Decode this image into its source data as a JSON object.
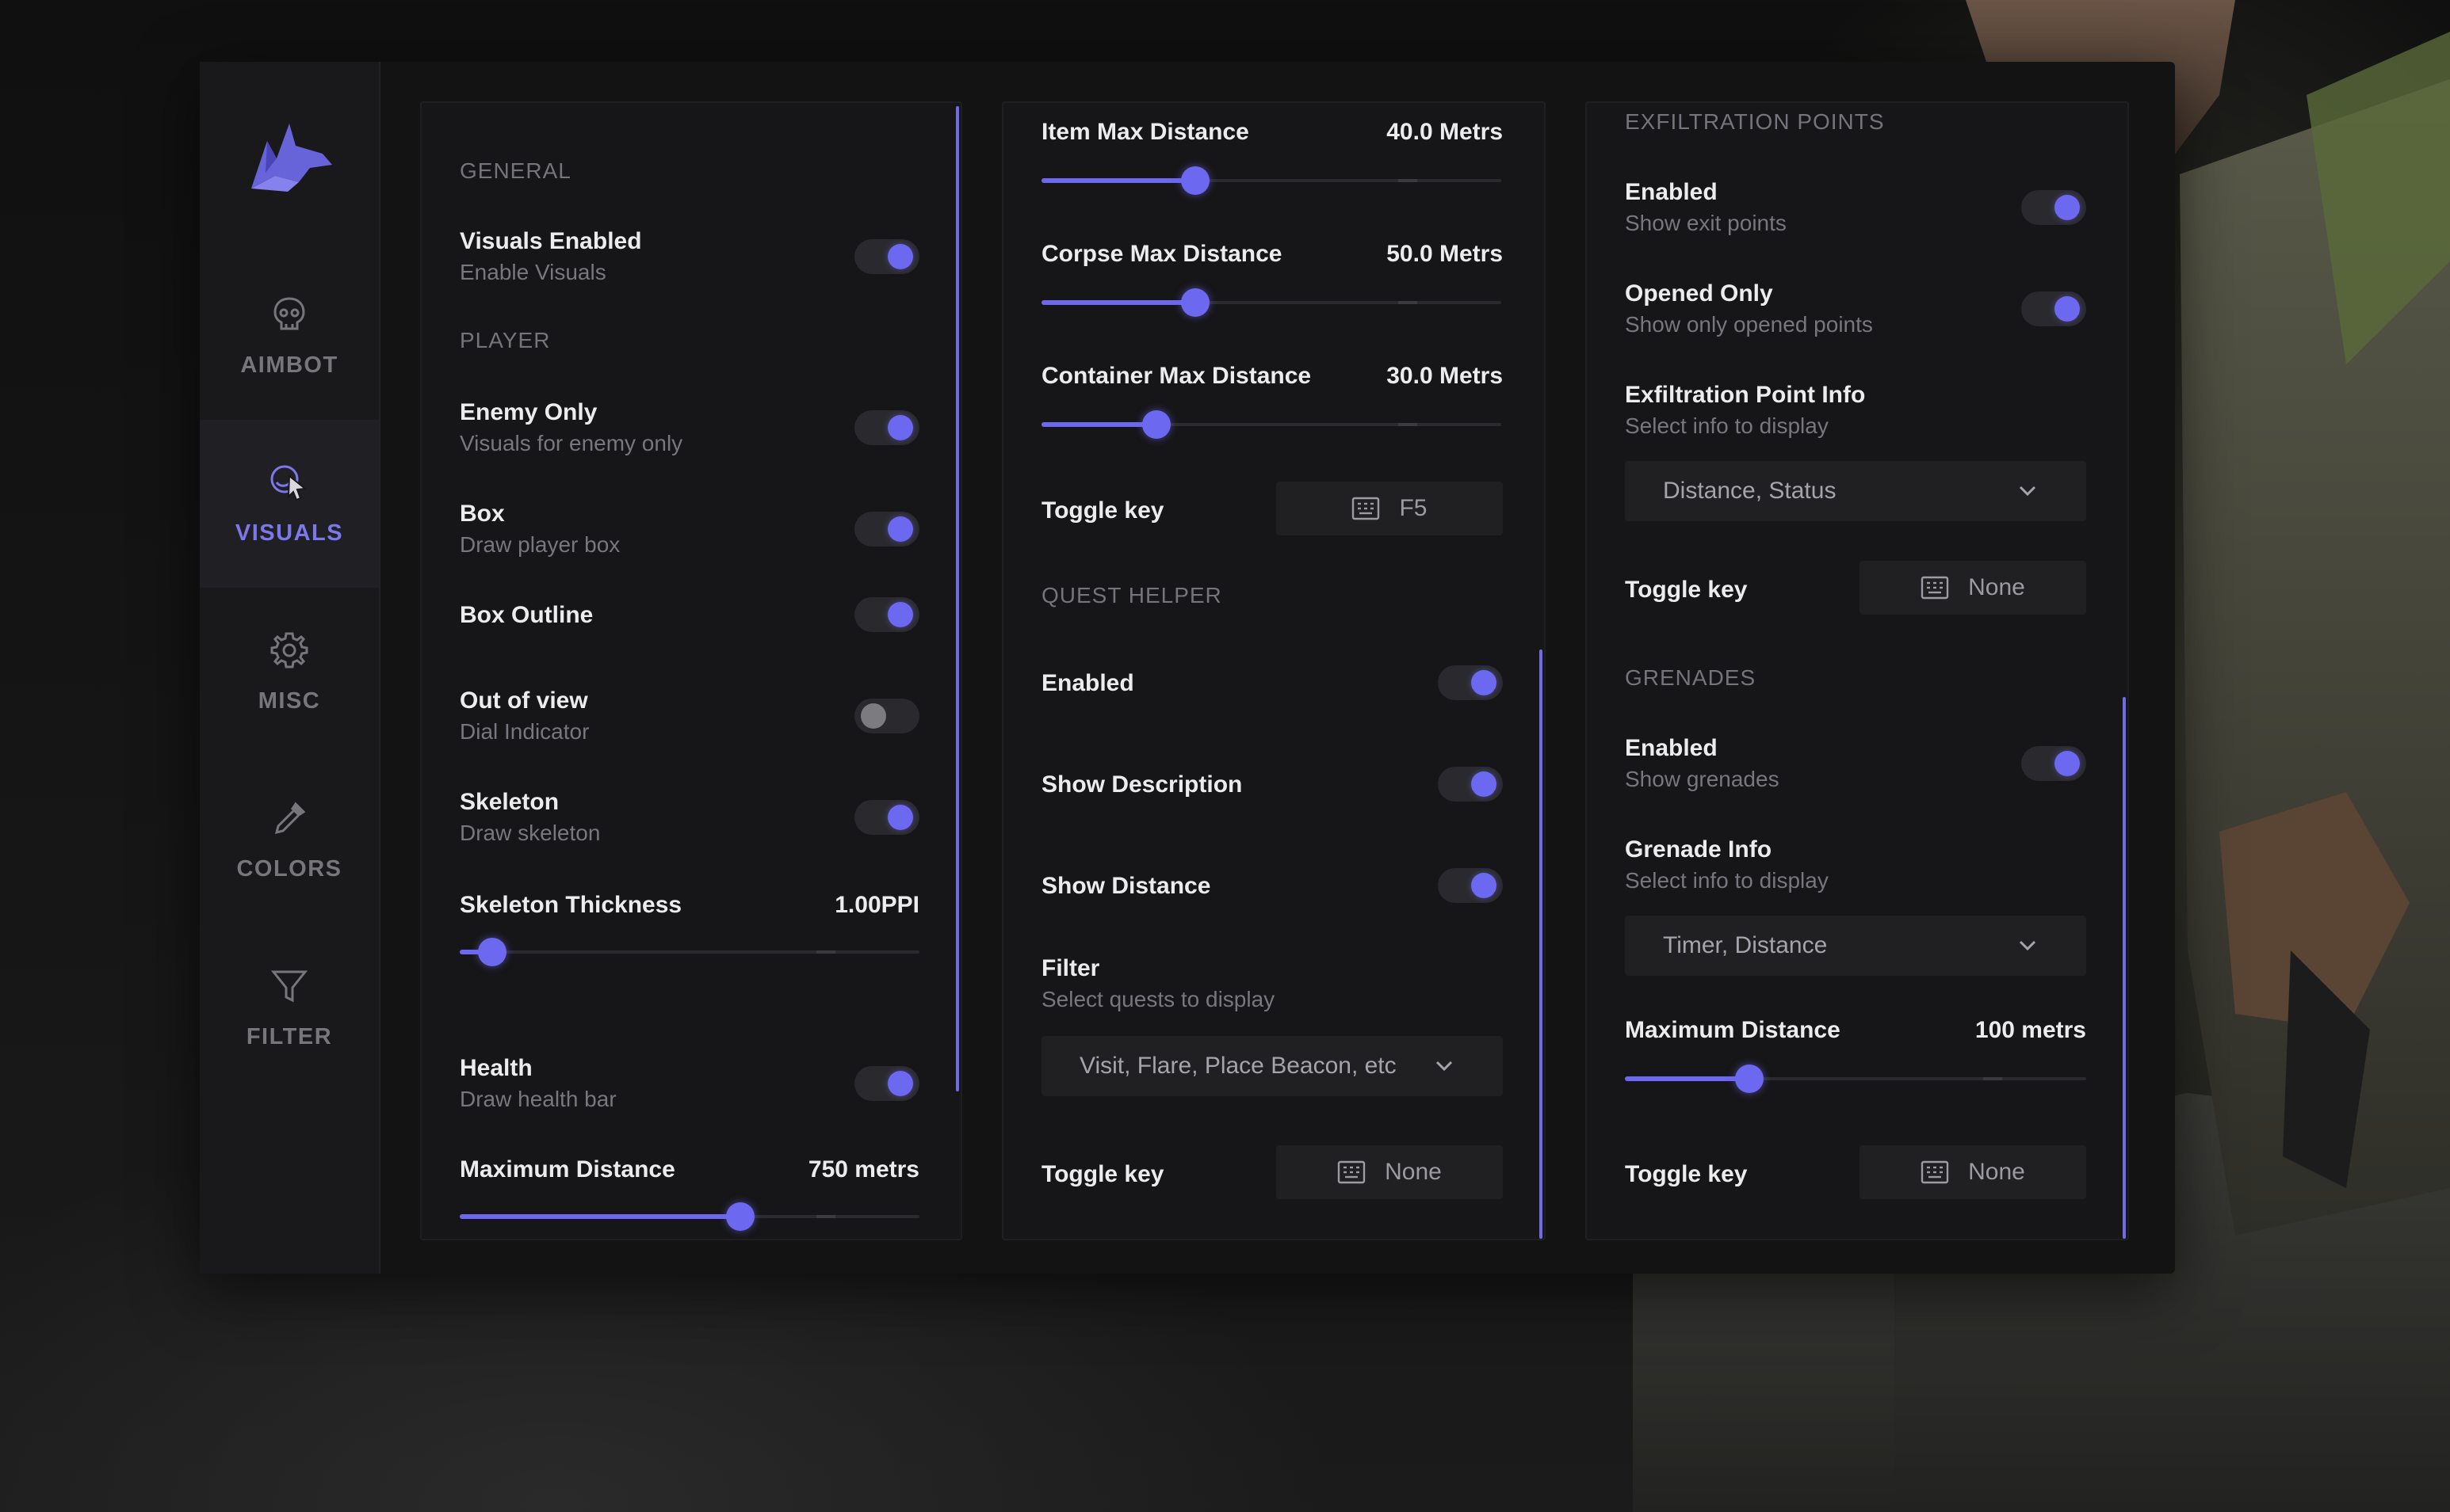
{
  "colors": {
    "accent": "#6c68f0",
    "panel": "#161618",
    "sidebar": "#19191b"
  },
  "sidebar": {
    "items": [
      {
        "label": "AIMBOT",
        "icon": "skull-icon",
        "active": false
      },
      {
        "label": "VISUALS",
        "icon": "eye-cursor-icon",
        "active": true
      },
      {
        "label": "MISC",
        "icon": "gear-icon",
        "active": false
      },
      {
        "label": "COLORS",
        "icon": "eyedropper-icon",
        "active": false
      },
      {
        "label": "FILTER",
        "icon": "funnel-icon",
        "active": false
      }
    ]
  },
  "col1": {
    "general_header": "GENERAL",
    "visuals_enabled": {
      "title": "Visuals Enabled",
      "sub": "Enable Visuals",
      "on": true
    },
    "player_header": "PLAYER",
    "enemy_only": {
      "title": "Enemy Only",
      "sub": "Visuals for enemy only",
      "on": true
    },
    "box": {
      "title": "Box",
      "sub": "Draw player box",
      "on": true
    },
    "box_outline": {
      "title": "Box Outline",
      "on": true
    },
    "out_of_view": {
      "title": "Out of view",
      "sub": "Dial Indicator",
      "on": false
    },
    "skeleton": {
      "title": "Skeleton",
      "sub": "Draw skeleton",
      "on": true
    },
    "skeleton_thickness": {
      "title": "Skeleton Thickness",
      "value": "1.00PPI",
      "fraction": 0.07
    },
    "health": {
      "title": "Health",
      "sub": "Draw health bar",
      "on": true
    },
    "max_distance": {
      "title": "Maximum Distance",
      "value": "750 metrs",
      "fraction": 0.61
    }
  },
  "col2": {
    "item_max": {
      "title": "Item Max Distance",
      "value": "40.0 Metrs",
      "fraction": 0.335
    },
    "corpse_max": {
      "title": "Corpse Max Distance",
      "value": "50.0 Metrs",
      "fraction": 0.335
    },
    "container_max": {
      "title": "Container Max Distance",
      "value": "30.0 Metrs",
      "fraction": 0.25
    },
    "toggle_key_1": {
      "title": "Toggle key",
      "key": "F5"
    },
    "quest_header": "QUEST HELPER",
    "quest_enabled": {
      "title": "Enabled",
      "on": true
    },
    "show_description": {
      "title": "Show Description",
      "on": true
    },
    "show_distance": {
      "title": "Show Distance",
      "on": true
    },
    "filter": {
      "title": "Filter",
      "sub": "Select quests to display",
      "selected": "Visit, Flare, Place Beacon, etc"
    },
    "toggle_key_2": {
      "title": "Toggle key",
      "key": "None"
    }
  },
  "col3": {
    "exfil_header": "EXFILTRATION POINTS",
    "exfil_enabled": {
      "title": "Enabled",
      "sub": "Show exit points",
      "on": true
    },
    "opened_only": {
      "title": "Opened Only",
      "sub": "Show only opened points",
      "on": true
    },
    "exfil_info": {
      "title": "Exfiltration Point Info",
      "sub": "Select info to display",
      "selected": "Distance, Status"
    },
    "toggle_key_1": {
      "title": "Toggle key",
      "key": "None"
    },
    "grenades_header": "GRENADES",
    "grenades_enabled": {
      "title": "Enabled",
      "sub": "Show grenades",
      "on": true
    },
    "grenade_info": {
      "title": "Grenade Info",
      "sub": "Select info to display",
      "selected": "Timer, Distance"
    },
    "max_distance": {
      "title": "Maximum Distance",
      "value": "100 metrs",
      "fraction": 0.27
    },
    "toggle_key_2": {
      "title": "Toggle key",
      "key": "None"
    }
  }
}
